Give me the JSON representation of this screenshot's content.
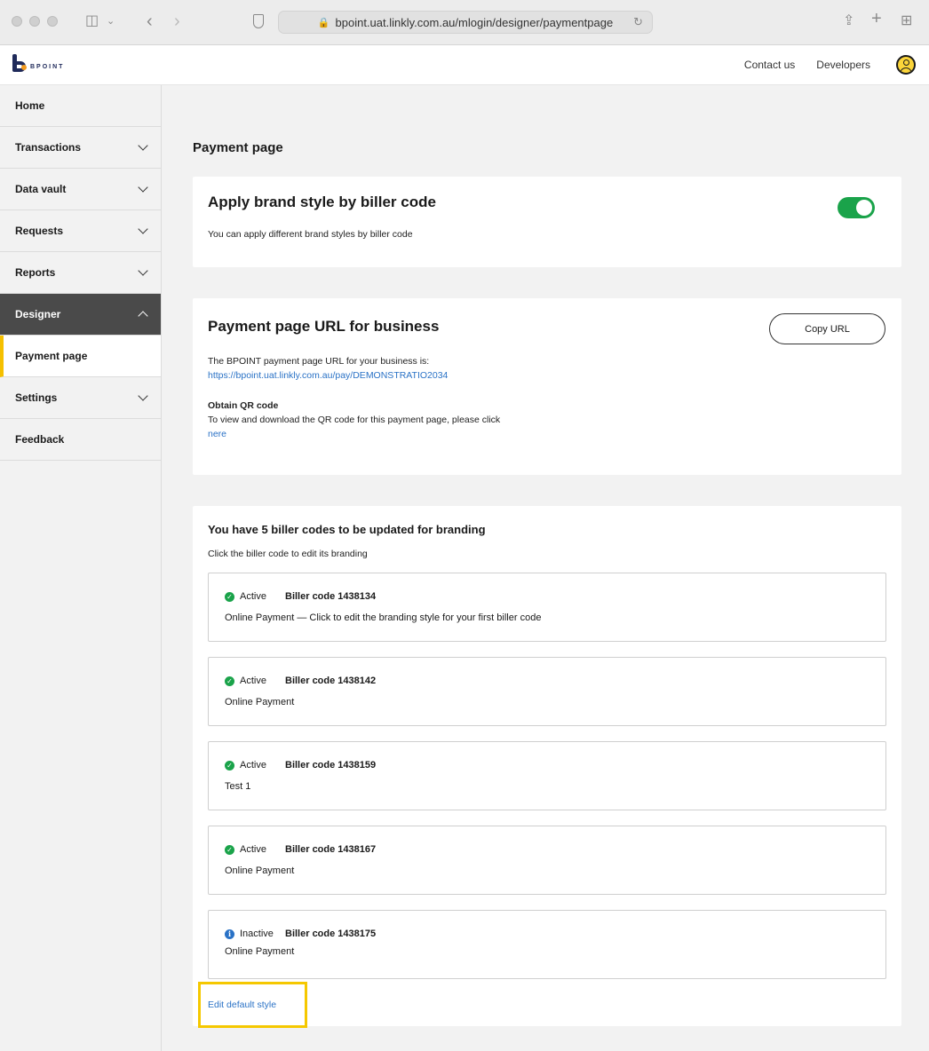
{
  "browser": {
    "url": "bpoint.uat.linkly.com.au/mlogin/designer/paymentpage"
  },
  "header": {
    "logo_text": "BPOINT",
    "links": [
      "Contact us",
      "Developers"
    ]
  },
  "sidebar": {
    "items": [
      {
        "label": "Home"
      },
      {
        "label": "Transactions"
      },
      {
        "label": "Data vault"
      },
      {
        "label": "Requests"
      },
      {
        "label": "Reports"
      },
      {
        "label": "Designer"
      },
      {
        "label": "Payment page"
      },
      {
        "label": "Settings"
      },
      {
        "label": "Feedback"
      }
    ]
  },
  "main": {
    "page_title": "Payment page",
    "brand_card": {
      "title": "Apply brand style by biller code",
      "description": "You can apply different brand styles by biller code",
      "toggle_on": true
    },
    "url_card": {
      "title": "Payment page URL for business",
      "copy_label": "Copy URL",
      "intro": "The BPOINT payment page URL for your business is:",
      "url": "https://bpoint.uat.linkly.com.au/pay/DEMONSTRATIO2034",
      "qr_title": "Obtain QR code",
      "qr_text": "To view and download the QR code for this payment page, please click",
      "qr_link": "nere"
    },
    "biller_card": {
      "title": "You have 5 biller codes to be updated for branding",
      "subtitle": "Click the biller code to edit its branding",
      "billers": [
        {
          "status": "Active",
          "code": "Biller code 1438134",
          "desc": "Online Payment — Click to edit the branding style for your first biller code"
        },
        {
          "status": "Active",
          "code": "Biller code 1438142",
          "desc": "Online Payment"
        },
        {
          "status": "Active",
          "code": "Biller code 1438159",
          "desc": "Test 1"
        },
        {
          "status": "Active",
          "code": "Biller code 1438167",
          "desc": "Online Payment"
        },
        {
          "status": "Inactive",
          "code": "Biller code 1438175",
          "desc": "Online Payment"
        }
      ],
      "edit_default": "Edit default style"
    }
  },
  "colors": {
    "accent_yellow": "#f5c800",
    "active_green": "#1aa34a",
    "link_blue": "#2a72c6",
    "sidebar_active": "#4a4a4a"
  }
}
